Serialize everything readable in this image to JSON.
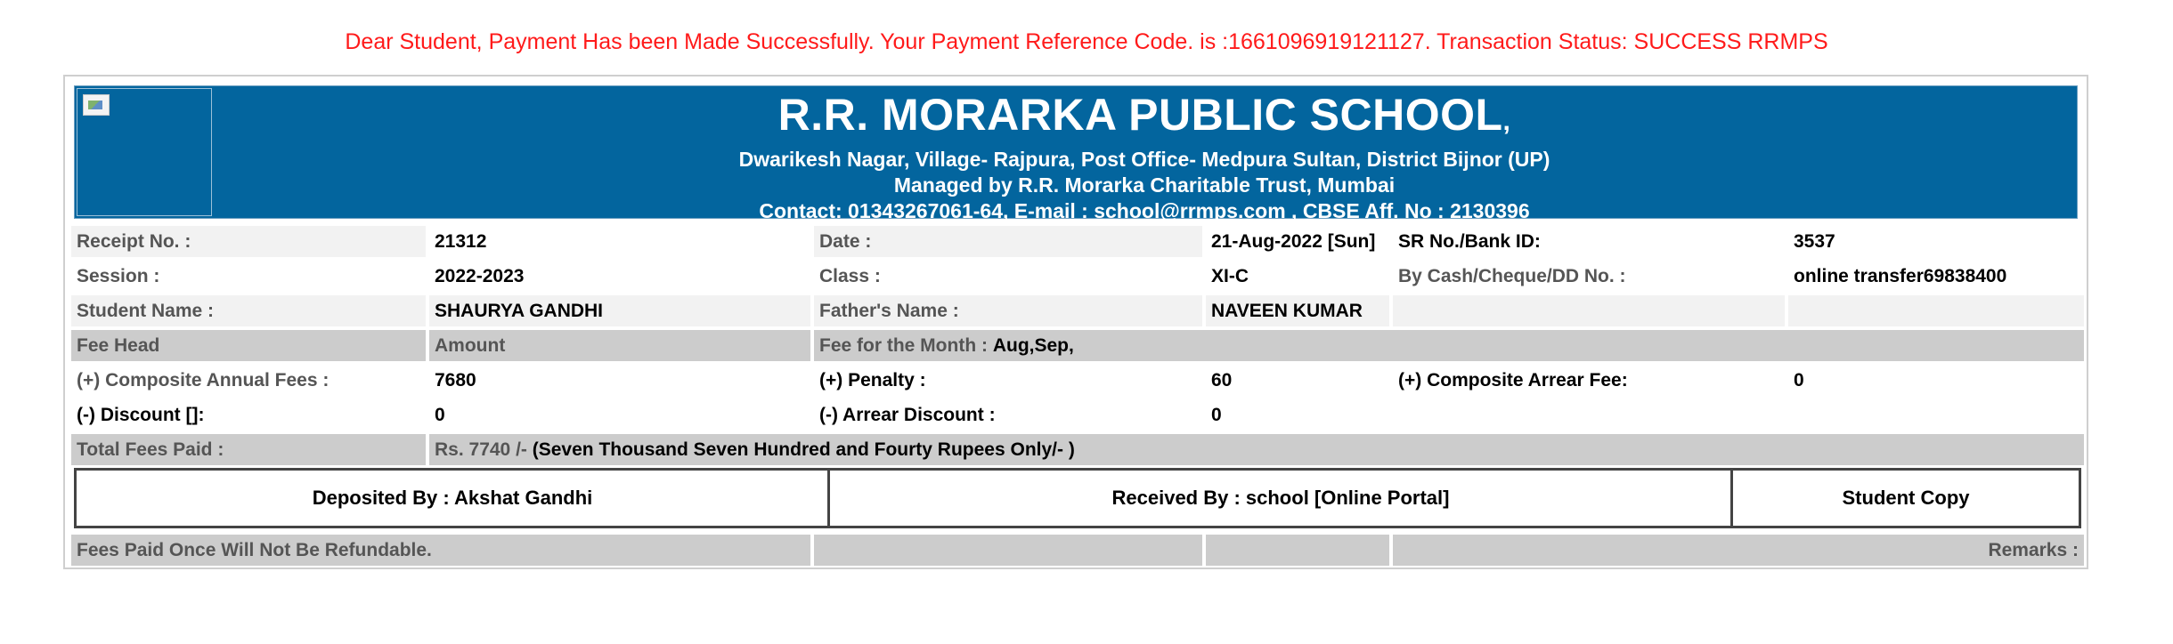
{
  "notice": "Dear Student, Payment Has been Made Successfully. Your Payment Reference Code. is :1661096919121127. Transaction Status: SUCCESS RRMPS",
  "header": {
    "school_name": "R.R. MORARKA PUBLIC SCHOOL",
    "school_name_suffix": ",",
    "address": "Dwarikesh Nagar, Village- Rajpura, Post Office- Medpura Sultan, District Bijnor (UP)",
    "managed_by": "Managed by R.R. Morarka Charitable Trust, Mumbai",
    "contact": "Contact: 01343267061-64, E-mail : school@rrmps.com , CBSE Aff. No : 2130396"
  },
  "details": {
    "receipt_no_label": "Receipt No. :",
    "receipt_no": "21312",
    "date_label": "Date :",
    "date": "21-Aug-2022 [Sun]",
    "sr_no_label": "SR No./Bank ID:",
    "sr_no": "3537",
    "session_label": "Session :",
    "session": "2022-2023",
    "class_label": "Class :",
    "class": "XI-C",
    "payment_mode_label": "By Cash/Cheque/DD No. :",
    "payment_mode": "online transfer69838400",
    "student_name_label": "Student Name :",
    "student_name": "SHAURYA GANDHI",
    "father_name_label": "Father's Name :",
    "father_name": "NAVEEN KUMAR"
  },
  "fees": {
    "fee_head_label": "Fee Head",
    "amount_label": "Amount",
    "fee_month_label": "Fee for the Month :",
    "fee_months": "Aug,Sep,",
    "composite_label": "(+) Composite Annual Fees :",
    "composite": "7680",
    "penalty_label": "(+) Penalty :",
    "penalty": "60",
    "arrear_fee_label": "(+) Composite Arrear Fee:",
    "arrear_fee": "0",
    "discount_label": "(-) Discount []:",
    "discount": "0",
    "arrear_discount_label": "(-) Arrear Discount :",
    "arrear_discount": "0",
    "total_label": "Total Fees Paid :",
    "total_amount": "Rs. 7740 /-",
    "total_words": "(Seven Thousand Seven Hundred and Fourty Rupees Only/- )"
  },
  "signatures": {
    "deposited_by": "Deposited By : Akshat Gandhi",
    "received_by": "Received By : school [Online Portal]",
    "copy_type": "Student Copy"
  },
  "footer": {
    "refund_note": "Fees Paid Once Will Not Be Refundable.",
    "remarks_label": "Remarks :"
  }
}
